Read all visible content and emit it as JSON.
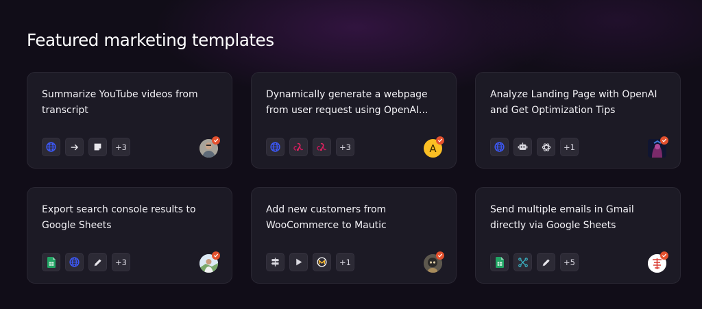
{
  "page": {
    "heading": "Featured marketing templates"
  },
  "templates": [
    {
      "title": "Summarize YouTube videos from transcript",
      "nodes": [
        "globe-icon",
        "arrow-right-icon",
        "sticky-note-icon"
      ],
      "more": "+3",
      "avatar": "creator-photo-avatar"
    },
    {
      "title": "Dynamically generate a webpage from user request using OpenAI...",
      "nodes": [
        "globe-icon",
        "webhook-icon",
        "webhook-icon"
      ],
      "more": "+3",
      "avatar": "letter-avatar",
      "avatar_letter": "A"
    },
    {
      "title": "Analyze Landing Page with OpenAI and Get Optimization Tips",
      "nodes": [
        "globe-icon",
        "robot-icon",
        "openai-icon"
      ],
      "more": "+1",
      "avatar": "creator-photo-avatar"
    },
    {
      "title": "Export search console results to Google Sheets",
      "nodes": [
        "google-sheets-icon",
        "globe-icon",
        "pencil-icon"
      ],
      "more": "+3",
      "avatar": "creator-photo-avatar"
    },
    {
      "title": "Add new customers from WooCommerce to Mautic",
      "nodes": [
        "signpost-icon",
        "play-icon",
        "mautic-icon"
      ],
      "more": "+1",
      "avatar": "creator-photo-avatar"
    },
    {
      "title": "Send multiple emails in Gmail directly via Google Sheets",
      "nodes": [
        "google-sheets-icon",
        "split-flow-icon",
        "pencil-icon"
      ],
      "more": "+5",
      "avatar": "creator-photo-avatar"
    }
  ],
  "colors": {
    "background": "#110d18",
    "card": "#1c1a25",
    "verified_badge": "#e4512e",
    "globe_blue": "#3d5afe",
    "webhook_pink": "#e0245e",
    "sheets_green": "#21a464",
    "avatar_yellow": "#fbbf24"
  }
}
